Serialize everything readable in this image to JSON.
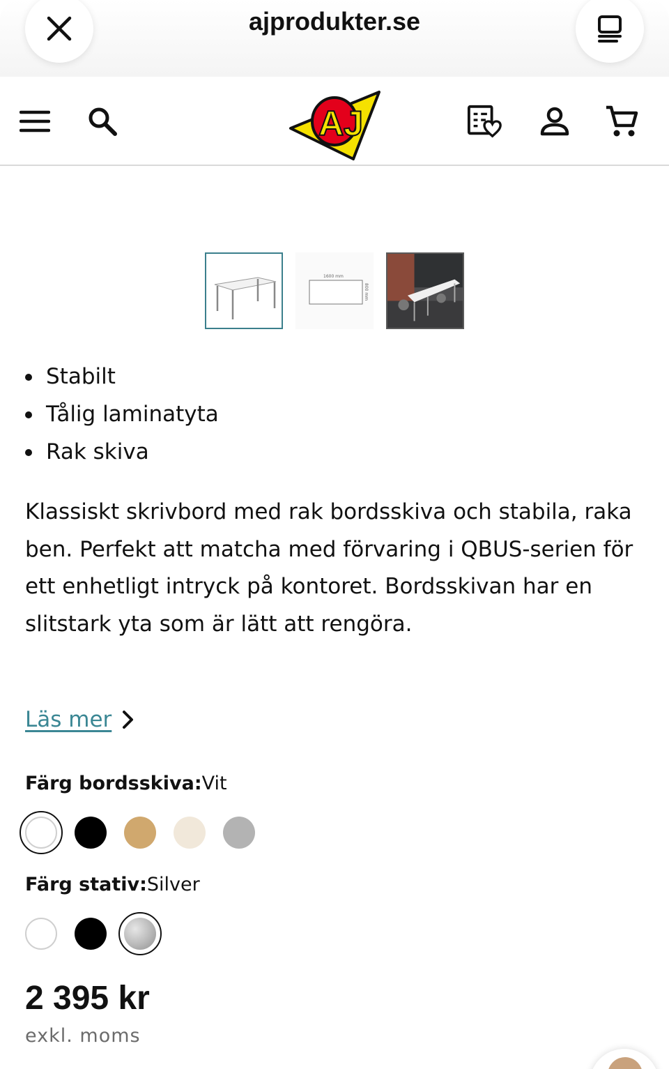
{
  "browser": {
    "url": "ajprodukter.se",
    "close_icon": "close-icon",
    "tabs_icon": "tabs-icon"
  },
  "header": {
    "menu_icon": "hamburger-menu-icon",
    "search_icon": "search-icon",
    "logo_text": "AJ",
    "wishlist_icon": "wishlist-icon",
    "account_icon": "account-icon",
    "cart_icon": "cart-icon"
  },
  "gallery": {
    "thumbnails": [
      "product-photo",
      "dimension-drawing",
      "room-photo"
    ],
    "active_index": 0,
    "drawing_width": "1600 mm",
    "drawing_depth": "800 mm"
  },
  "features": [
    "Stabilt",
    "Tålig laminatyta",
    "Rak skiva"
  ],
  "description": "Klassiskt skrivbord med rak bordsskiva och stabila, raka ben. Perfekt att matcha med förvaring i QBUS-serien för ett enhetligt intryck på kontoret. Bordsskivan har en slitstark yta som är lätt att rengöra.",
  "read_more": {
    "label": "Läs mer"
  },
  "options": {
    "tabletop": {
      "label": "Färg bordsskiva:",
      "value": "Vit",
      "swatches": [
        "#ffffff",
        "#000000",
        "#d0a86e",
        "#f1e8da",
        "#b3b3b3"
      ],
      "selected_index": 0
    },
    "frame": {
      "label": "Färg stativ:",
      "value": "Silver",
      "swatches": [
        "#ffffff",
        "#000000",
        "#b8b8b8"
      ],
      "selected_index": 2
    }
  },
  "price": {
    "amount": "2 395 kr",
    "note": "exkl. moms"
  },
  "colors": {
    "link": "#3b8794",
    "active_thumb_border": "#3b7f8c",
    "logo_yellow": "#f5e100",
    "logo_red": "#e3001b"
  }
}
